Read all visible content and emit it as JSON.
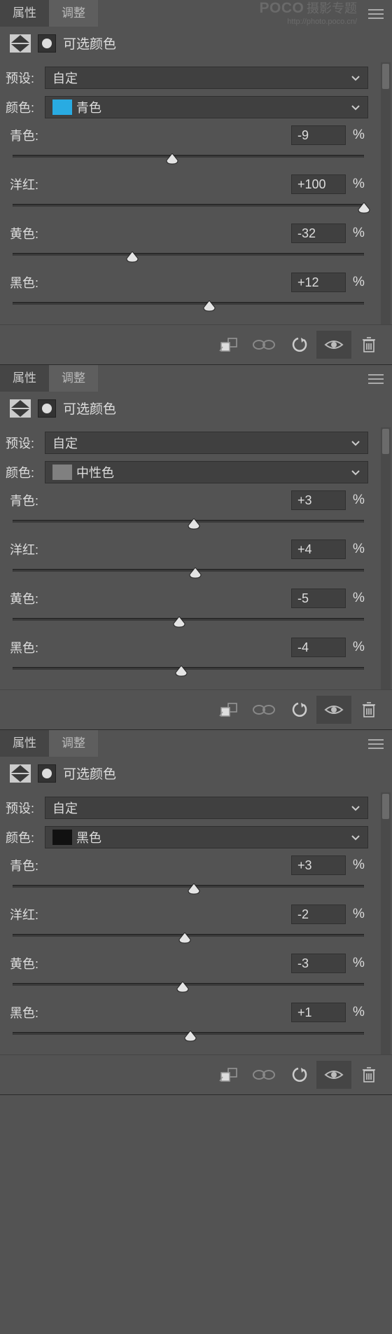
{
  "watermark": {
    "logo": "POCO",
    "cn": "摄影专题",
    "url": "http://photo.poco.cn/"
  },
  "tabs": {
    "properties": "属性",
    "adjustments": "调整"
  },
  "labels": {
    "panel_title": "可选颜色",
    "preset": "预设:",
    "color": "颜色:",
    "cyan": "青色:",
    "magenta": "洋红:",
    "yellow": "黄色:",
    "black": "黑色:",
    "percent": "%"
  },
  "panels": [
    {
      "preset": "自定",
      "color_name": "青色",
      "swatch": "#29abe2",
      "sliders": {
        "cyan": {
          "value": "-9",
          "pos": 45.5
        },
        "magenta": {
          "value": "+100",
          "pos": 100
        },
        "yellow": {
          "value": "-32",
          "pos": 34
        },
        "black": {
          "value": "+12",
          "pos": 56
        }
      }
    },
    {
      "preset": "自定",
      "color_name": "中性色",
      "swatch": "#808080",
      "sliders": {
        "cyan": {
          "value": "+3",
          "pos": 51.5
        },
        "magenta": {
          "value": "+4",
          "pos": 52
        },
        "yellow": {
          "value": "-5",
          "pos": 47.5
        },
        "black": {
          "value": "-4",
          "pos": 48
        }
      }
    },
    {
      "preset": "自定",
      "color_name": "黑色",
      "swatch": "#111111",
      "sliders": {
        "cyan": {
          "value": "+3",
          "pos": 51.5
        },
        "magenta": {
          "value": "-2",
          "pos": 49
        },
        "yellow": {
          "value": "-3",
          "pos": 48.5
        },
        "black": {
          "value": "+1",
          "pos": 50.5
        }
      }
    }
  ]
}
